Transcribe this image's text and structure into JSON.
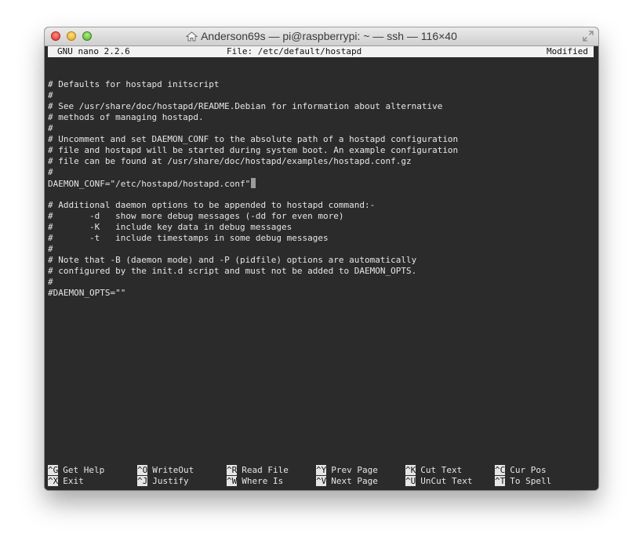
{
  "window": {
    "title": "Anderson69s — pi@raspberrypi: ~ — ssh — 116×40"
  },
  "nano": {
    "version": "GNU nano 2.2.6",
    "file": "File: /etc/default/hostapd",
    "status": "Modified",
    "lines": [
      "",
      "# Defaults for hostapd initscript",
      "#",
      "# See /usr/share/doc/hostapd/README.Debian for information about alternative",
      "# methods of managing hostapd.",
      "#",
      "# Uncomment and set DAEMON_CONF to the absolute path of a hostapd configuration",
      "# file and hostapd will be started during system boot. An example configuration",
      "# file can be found at /usr/share/doc/hostapd/examples/hostapd.conf.gz",
      "#",
      "DAEMON_CONF=\"/etc/hostapd/hostapd.conf\"",
      "",
      "# Additional daemon options to be appended to hostapd command:-",
      "#       -d   show more debug messages (-dd for even more)",
      "#       -K   include key data in debug messages",
      "#       -t   include timestamps in some debug messages",
      "#",
      "# Note that -B (daemon mode) and -P (pidfile) options are automatically",
      "# configured by the init.d script and must not be added to DAEMON_OPTS.",
      "#",
      "#DAEMON_OPTS=\"\""
    ],
    "cursor_line": 10,
    "shortcuts": [
      [
        {
          "key": "^G",
          "label": "Get Help"
        },
        {
          "key": "^O",
          "label": "WriteOut"
        },
        {
          "key": "^R",
          "label": "Read File"
        },
        {
          "key": "^Y",
          "label": "Prev Page"
        },
        {
          "key": "^K",
          "label": "Cut Text"
        },
        {
          "key": "^C",
          "label": "Cur Pos"
        }
      ],
      [
        {
          "key": "^X",
          "label": "Exit"
        },
        {
          "key": "^J",
          "label": "Justify"
        },
        {
          "key": "^W",
          "label": "Where Is"
        },
        {
          "key": "^V",
          "label": "Next Page"
        },
        {
          "key": "^U",
          "label": "UnCut Text"
        },
        {
          "key": "^T",
          "label": "To Spell"
        }
      ]
    ]
  }
}
